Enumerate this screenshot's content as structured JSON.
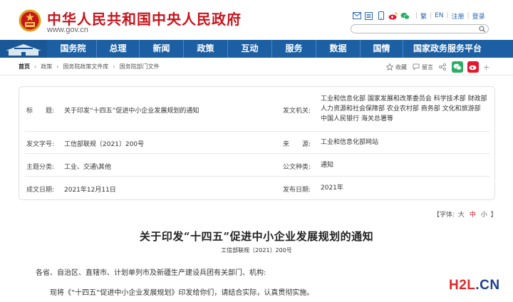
{
  "header": {
    "title": "中华人民共和国中央人民政府",
    "url": "www.gov.cn",
    "links": [
      "繁",
      "EN",
      "注册",
      "登录"
    ],
    "icons": [
      "mail-icon",
      "sitemap-icon",
      "mobile-icon",
      "weibo-icon",
      "wechat-icon"
    ],
    "search_placeholder": ""
  },
  "nav": {
    "items": [
      "国务院",
      "总理",
      "新闻",
      "政策",
      "互动",
      "服务",
      "数据",
      "国情",
      "国家政务服务平台"
    ]
  },
  "breadcrumb": {
    "items": [
      "首页",
      "政策",
      "国务院政策文件库",
      "国务院部门文件"
    ]
  },
  "share": {
    "favorite": "收藏",
    "comment": "留言"
  },
  "info": {
    "title_label": "标　　题:",
    "title_value": "关于印发“十四五”促进中小企业发展规划的通知",
    "issuer_label": "发文机关:",
    "issuer_value": "工业和信息化部 国家发展和改革委员会 科学技术部 财政部 人力资源和社会保障部 农业农村部 商务部 文化和旅游部 中国人民银行 海关总署等",
    "docno_label": "发文字号:",
    "docno_value": "工信部联规〔2021〕200号",
    "source_label": "来　　源:",
    "source_value": "工业和信息化部网站",
    "topic_label": "主题分类:",
    "topic_value": "工业、交通\\其他",
    "type_label": "公文种类:",
    "type_value": "通知",
    "date_label": "成文日期:",
    "date_value": "2021年12月11日",
    "pubdate_label": "发布日期:",
    "pubdate_value": "2021年"
  },
  "fontsize": {
    "label": "【字体:",
    "large": "大",
    "medium": "中",
    "small": "小",
    "close": "】"
  },
  "article": {
    "title": "关于印发“十四五”促进中小企业发展规划的通知",
    "docno": "工信部联规〔2021〕200号",
    "para1": "各省、自治区、直辖市、计划单列市及新疆生产建设兵团有关部门、机构:",
    "para2": "现将《“十四五”促进中小企业发展规划》印发给你们，请结合实际，认真贯彻实施。"
  },
  "watermark": {
    "part1": "H2L",
    "part2": ".CN"
  },
  "colors": {
    "brand_red": "#c8151d",
    "nav_blue": "#1c5fa3",
    "link_blue": "#2b66b0",
    "wechat_green": "#2aae67",
    "weibo_red": "#e6162d"
  }
}
